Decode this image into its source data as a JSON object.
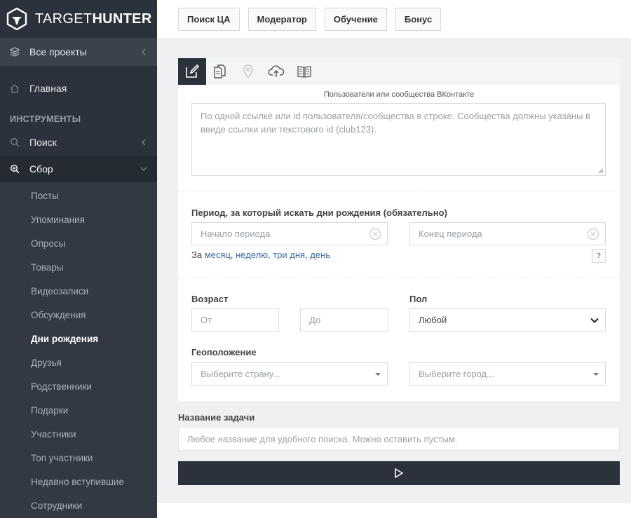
{
  "brand": {
    "light": "TARGET",
    "bold": "HUNTER"
  },
  "sidebar": {
    "all_projects": "Все проекты",
    "home": "Главная",
    "section_tools": "ИНСТРУМЕНТЫ",
    "search": "Поиск",
    "collect": "Сбор",
    "sub_items": [
      "Посты",
      "Упоминания",
      "Опросы",
      "Товары",
      "Видеозаписи",
      "Обсуждения",
      "Дни рождения",
      "Друзья",
      "Родственники",
      "Подарки",
      "Участники",
      "Топ участники",
      "Недавно вступившие",
      "Сотрудники"
    ],
    "active_sub_index": 6
  },
  "topbar": {
    "buttons": [
      "Поиск ЦА",
      "Модератор",
      "Обучение",
      "Бонус"
    ]
  },
  "form": {
    "tabs_icons": [
      "edit-icon",
      "copy-icon",
      "map-pin-icon",
      "cloud-upload-icon",
      "book-icon"
    ],
    "caption": "Пользователи или сообщества ВКонтакте",
    "textarea_placeholder": "По одной ссылке или id пользователя/сообщества в строке. Сообщества должны указаны в ввиде ссылки или текстового id (club123).",
    "period_label": "Период, за который искать дни рождения (обязательно)",
    "period_start_placeholder": "Начало периода",
    "period_end_placeholder": "Конец периода",
    "quick_prefix": "За",
    "quick_links": [
      "месяц",
      "неделю",
      "три дня",
      "день"
    ],
    "help": "?",
    "age_label": "Возраст",
    "age_from": "От",
    "age_to": "До",
    "gender_label": "Пол",
    "gender_value": "Любой",
    "geo_label": "Геоположение",
    "country_placeholder": "Выберите страну...",
    "city_placeholder": "Выберите город..."
  },
  "task": {
    "label": "Название задачи",
    "placeholder": "Любое название для удобного поиска. Можно оставить пустым."
  },
  "footer": {
    "text": ""
  }
}
